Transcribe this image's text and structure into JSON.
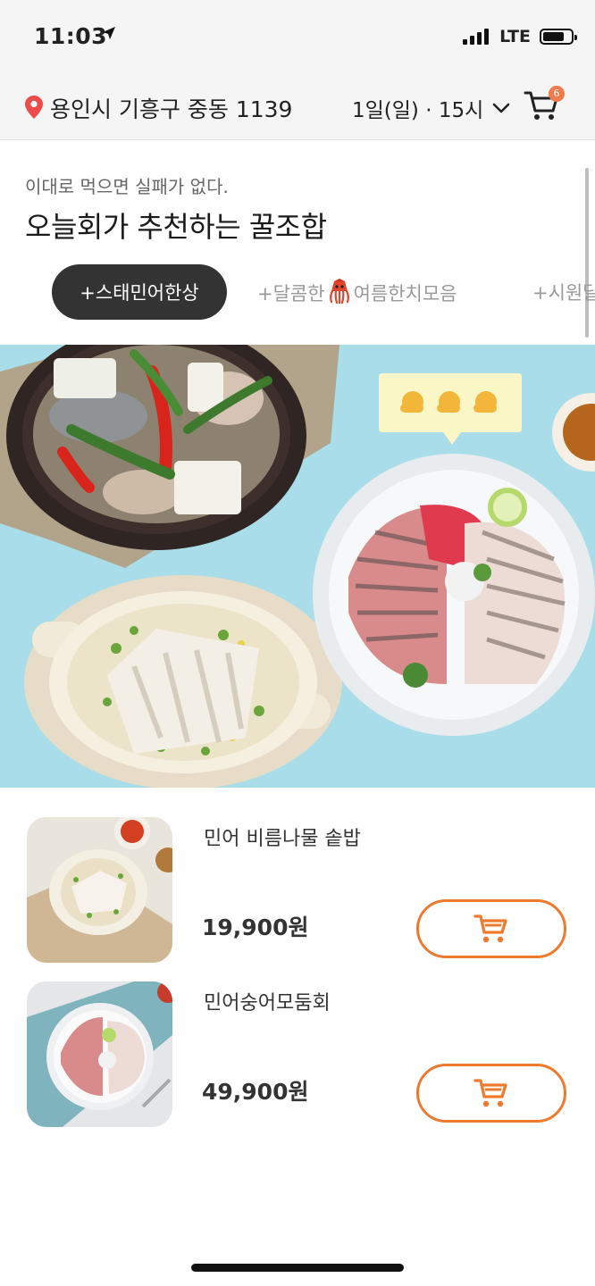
{
  "status": {
    "time": "11:03",
    "network": "LTE",
    "battery_level": 0.75
  },
  "header": {
    "address": "용인시 기흥구 중동 1139",
    "delivery_time": "1일(일) · 15시",
    "cart_count": "6"
  },
  "section": {
    "subtitle": "이대로 먹으면 실패가 없다.",
    "title": "오늘회가 추천하는 꿀조합",
    "chips": [
      {
        "label": "+스태민어한상",
        "active": true
      },
      {
        "label_prefix": "+달콤한",
        "label_suffix": "여름한치모음",
        "icon": "squid-icon",
        "active": false
      },
      {
        "label": "+시원달",
        "active": false
      }
    ]
  },
  "hero": {
    "badge_icons": [
      "flexed-biceps-icon",
      "flexed-biceps-icon",
      "flexed-biceps-icon"
    ]
  },
  "products": [
    {
      "name": "민어 비름나물 솥밥",
      "price": "19,900원"
    },
    {
      "name": "민어숭어모둠회",
      "price": "49,900원"
    }
  ],
  "colors": {
    "accent": "#ee7a2f",
    "hero_bg": "#a9dde9",
    "chip_active_bg": "#333333",
    "pin": "#ee4b4b"
  }
}
